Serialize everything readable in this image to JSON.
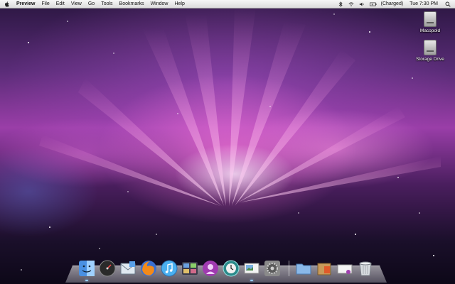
{
  "menubar": {
    "app_name": "Preview",
    "items": [
      "File",
      "Edit",
      "View",
      "Go",
      "Tools",
      "Bookmarks",
      "Window",
      "Help"
    ],
    "battery_status": "(Charged)",
    "clock": "Tue 7:30 PM"
  },
  "desktop": {
    "icons": [
      {
        "label": "Macopold",
        "icon": "hard-drive-icon"
      },
      {
        "label": "Storage Drive",
        "icon": "hard-drive-icon"
      }
    ]
  },
  "dock": {
    "apps": [
      "finder-icon",
      "dashboard-icon",
      "mail-icon",
      "firefox-icon",
      "itunes-icon",
      "spaces-icon",
      "party-icon",
      "time-machine-icon",
      "preview-icon",
      "system-preferences-icon"
    ],
    "stacks": [
      "applications-folder-icon",
      "downloads-stack-icon",
      "documents-stack-icon",
      "trash-icon"
    ]
  },
  "colors": {
    "menubar": "#e8e8e8",
    "wallpaper_accent": "#e060c8",
    "running_indicator": "#9ad0ff"
  }
}
